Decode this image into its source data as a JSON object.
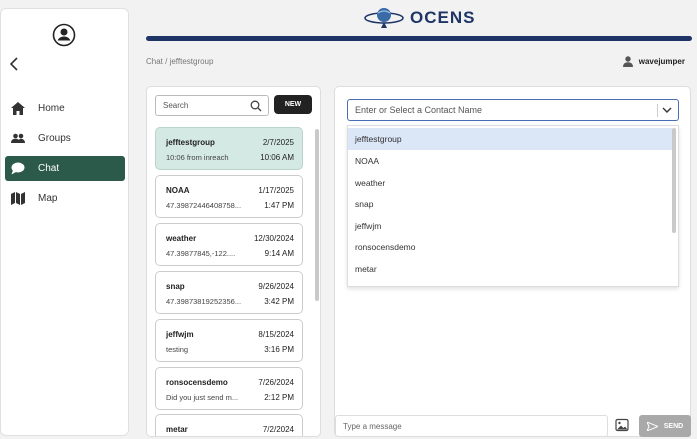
{
  "brand": {
    "name": "OCENS"
  },
  "sidebar": {
    "items": [
      {
        "label": "Home",
        "icon": "home-icon"
      },
      {
        "label": "Groups",
        "icon": "groups-icon"
      },
      {
        "label": "Chat",
        "icon": "chat-icon",
        "active": true
      },
      {
        "label": "Map",
        "icon": "map-icon"
      }
    ]
  },
  "breadcrumb": "Chat / jefftestgroup",
  "user": {
    "name": "wavejumper"
  },
  "list": {
    "search_placeholder": "Search",
    "new_label": "NEW",
    "conversations": [
      {
        "name": "jefftestgroup",
        "date": "2/7/2025",
        "preview": "10:06 from inreach",
        "time": "10:06 AM",
        "active": true
      },
      {
        "name": "NOAA",
        "date": "1/17/2025",
        "preview": "47.39872446408758...",
        "time": "1:47 PM"
      },
      {
        "name": "weather",
        "date": "12/30/2024",
        "preview": "47.39877845,-122....",
        "time": "9:14 AM"
      },
      {
        "name": "snap",
        "date": "9/26/2024",
        "preview": "47.39873819252356...",
        "time": "3:42 PM"
      },
      {
        "name": "jeffwjm",
        "date": "8/15/2024",
        "preview": "testing",
        "time": "3:16 PM"
      },
      {
        "name": "ronsocensdemo",
        "date": "7/26/2024",
        "preview": "Did you just send m...",
        "time": "2:12 PM"
      },
      {
        "name": "metar",
        "date": "7/2/2024",
        "preview": "",
        "time": ""
      }
    ]
  },
  "chat": {
    "contact_placeholder": "Enter or Select a Contact Name",
    "dropdown_options": [
      "jefftestgroup",
      "NOAA",
      "weather",
      "snap",
      "jeffwjm",
      "ronsocensdemo",
      "metar",
      "..."
    ],
    "message_placeholder": "Type a message",
    "send_label": "SEND"
  },
  "colors": {
    "active_nav": "#2b5a4b",
    "brand_blue": "#1e3566",
    "active_row": "#d5e9e4"
  }
}
